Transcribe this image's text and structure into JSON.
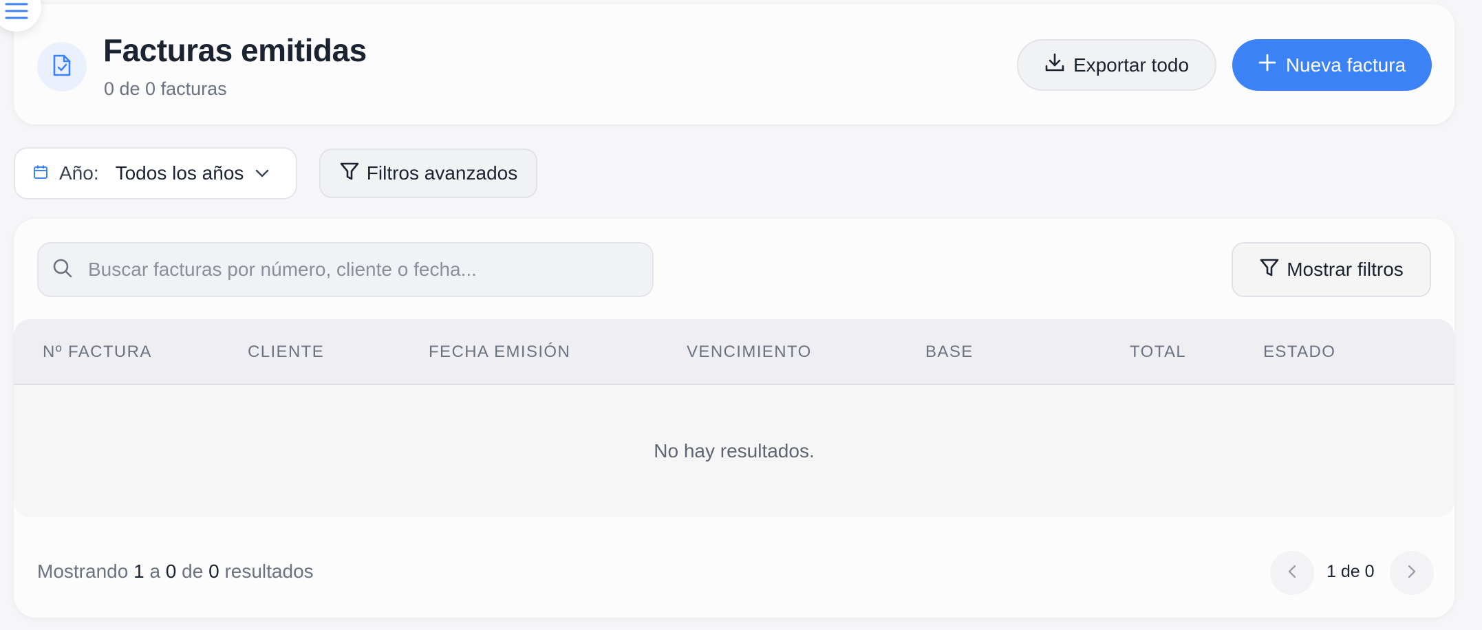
{
  "header": {
    "title": "Facturas emitidas",
    "subtitle": "0 de 0 facturas",
    "export_label": "Exportar todo",
    "new_label": "Nueva factura"
  },
  "filters": {
    "year_label": "Año:",
    "year_value": "Todos los años",
    "advanced_label": "Filtros avanzados"
  },
  "table": {
    "search_placeholder": "Buscar facturas por número, cliente o fecha...",
    "show_filters_label": "Mostrar filtros",
    "columns": [
      "Nº FACTURA",
      "CLIENTE",
      "FECHA EMISIÓN",
      "VENCIMIENTO",
      "BASE",
      "TOTAL",
      "ESTADO"
    ],
    "empty_message": "No hay resultados."
  },
  "footer": {
    "prefix": "Mostrando",
    "from": "1",
    "sep_a": "a",
    "to": "0",
    "sep_de": "de",
    "total": "0",
    "suffix": "resultados",
    "page_label": "1 de 0"
  },
  "colors": {
    "accent": "#3b82f6",
    "background": "#f6f6f8",
    "card": "#fcfcfc",
    "muted_text": "#6b7280"
  },
  "icons": [
    "menu-icon",
    "document-check-icon",
    "download-icon",
    "plus-icon",
    "calendar-icon",
    "chevron-down-icon",
    "filter-icon",
    "search-icon",
    "chevron-left-icon",
    "chevron-right-icon"
  ]
}
